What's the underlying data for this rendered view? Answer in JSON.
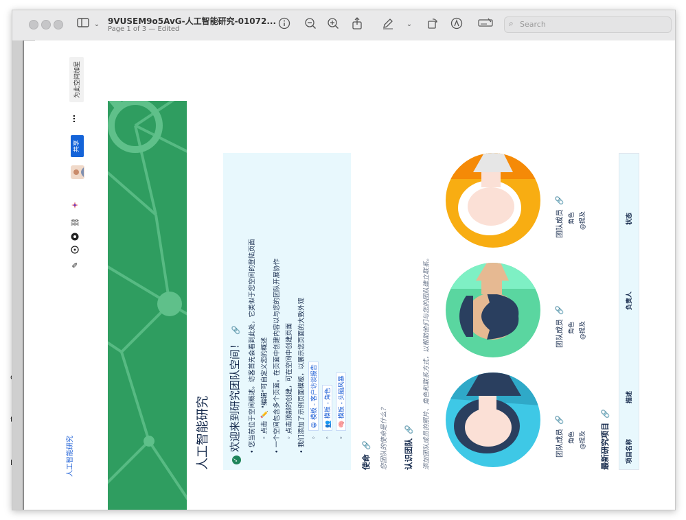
{
  "window": {
    "title": "9VUSEM9o5AvG-人工智能研究-01072...",
    "subtitle": "Page 1 of 3 — Edited",
    "search_placeholder": "Search"
  },
  "desktop_glyphs": [
    "o",
    "t",
    "lc"
  ],
  "page": {
    "space_link": "人工智能研究",
    "share_label": "共享",
    "more_label": "⋯",
    "add_space_label": "为此空间加星",
    "title": "人工智能研究",
    "welcome": {
      "title": "欢迎来到研究团队空间！",
      "line1": "您当前位于空间概述。访客首先会看到此处，它类似于您空间的登陆页面",
      "line2": "点击 ✏️ \"编辑\"可自定义您的概述",
      "line3": "一个空间包含多个页面。在页面中创建内容以与您的团队开展协作",
      "line4": "点击顶部的创建，可在空间中创建页面",
      "line5": "我们添加了示例页面模板，以展示您页面的大致外观",
      "template1": "模板 - 客户访谈报告",
      "template2": "模板 - 角色",
      "template3": "模板 - 头脑风暴"
    },
    "mission": {
      "heading": "使命",
      "placeholder": "您团队的使命是什么？"
    },
    "team": {
      "heading": "认识团队",
      "placeholder": "添加团队成员的照片、角色和联系方式，以帮助他们与您的团队建立联系。",
      "members": [
        {
          "name": "团队成员",
          "role": "角色",
          "mention": "@提及"
        },
        {
          "name": "团队成员",
          "role": "角色",
          "mention": "@提及"
        },
        {
          "name": "团队成员",
          "role": "角色",
          "mention": "@提及"
        }
      ]
    },
    "projects": {
      "heading": "最新研究项目",
      "columns": [
        "项目名称",
        "描述",
        "负责人",
        "状态"
      ]
    }
  },
  "colors": {
    "banner": "#2f9d60",
    "panel": "#e8f8fd",
    "share": "#1463d8",
    "avatar_blue": "#3ec8e6",
    "avatar_green": "#5ad6a0",
    "avatar_orange": "#f8ad12"
  }
}
